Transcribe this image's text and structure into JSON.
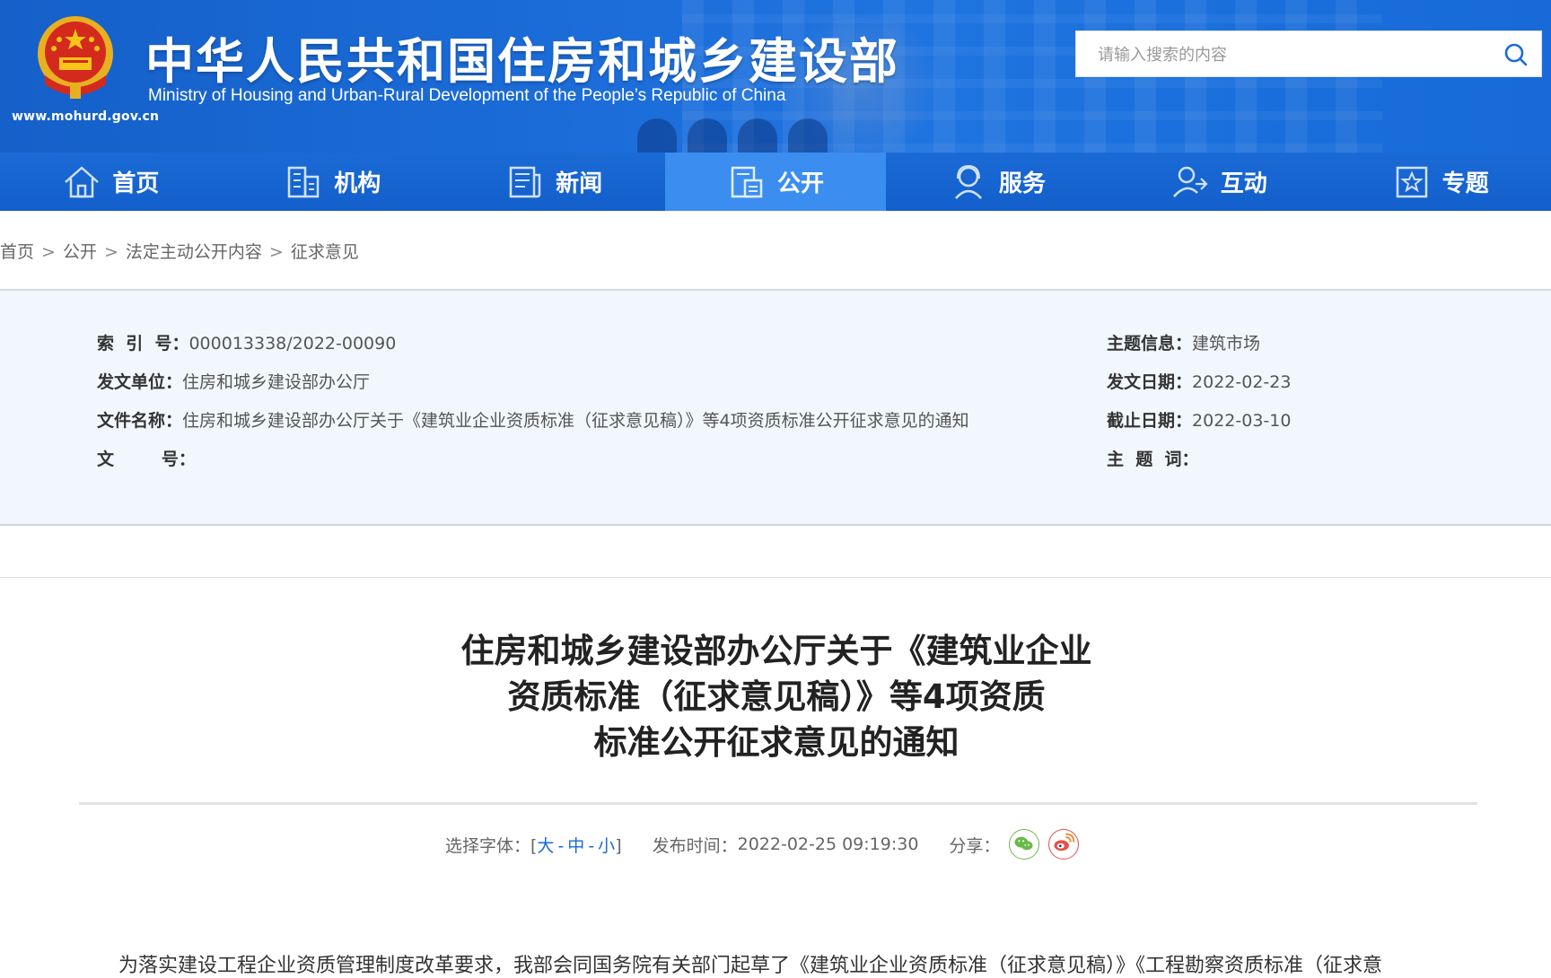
{
  "header": {
    "title": "中华人民共和国住房和城乡建设部",
    "subtitle": "Ministry of Housing and Urban-Rural Development of the People’s Republic of China",
    "url": "www.mohurd.gov.cn",
    "search_placeholder": "请输入搜索的内容"
  },
  "nav": {
    "items": [
      {
        "label": "首页",
        "icon": "home-icon"
      },
      {
        "label": "机构",
        "icon": "building-icon"
      },
      {
        "label": "新闻",
        "icon": "news-icon"
      },
      {
        "label": "公开",
        "icon": "disclosure-icon",
        "active": true
      },
      {
        "label": "服务",
        "icon": "service-icon"
      },
      {
        "label": "互动",
        "icon": "interaction-icon"
      },
      {
        "label": "专题",
        "icon": "topic-icon"
      }
    ]
  },
  "breadcrumb": {
    "items": [
      "首页",
      "公开",
      "法定主动公开内容",
      "征求意见"
    ],
    "separator": ">"
  },
  "info": {
    "index_label": "索  引  号：",
    "index_value": "000013338/2022-00090",
    "issuer_label": "发文单位：",
    "issuer_value": "住房和城乡建设部办公厅",
    "filename_label": "文件名称：",
    "filename_value": "住房和城乡建设部办公厅关于《建筑业企业资质标准（征求意见稿）》等4项资质标准公开征求意见的通知",
    "docno_label": "文        号：",
    "docno_value": "",
    "topic_label": "主题信息：",
    "topic_value": "建筑市场",
    "date_label": "发文日期：",
    "date_value": "2022-02-23",
    "deadline_label": "截止日期：",
    "deadline_value": "2022-03-10",
    "keywords_label": "主  题  词：",
    "keywords_value": ""
  },
  "article": {
    "title_lines": [
      "住房和城乡建设部办公厅关于《建筑业企业",
      "资质标准（征求意见稿）》等4项资质",
      "标准公开征求意见的通知"
    ],
    "font_select_label": "选择字体：[",
    "font_large": "大",
    "font_medium": "中",
    "font_small": "小",
    "font_dash": "-",
    "font_close": "]",
    "publish_label": "发布时间：",
    "publish_value": "2022-02-25 09:19:30",
    "share_label": "分享：",
    "body_first_line": "为落实建设工程企业资质管理制度改革要求，我部会同国务院有关部门起草了《建筑业企业资质标准（征求意见稿）》《工程勘察资质标准（征求意"
  },
  "colors": {
    "header_blue": "#1d6fdc",
    "nav_active": "#3b8ef0",
    "info_bg": "#f2f7fd",
    "link_blue": "#1a6ad6",
    "wechat_green": "#6aba4a",
    "weibo_red": "#e5504a"
  }
}
